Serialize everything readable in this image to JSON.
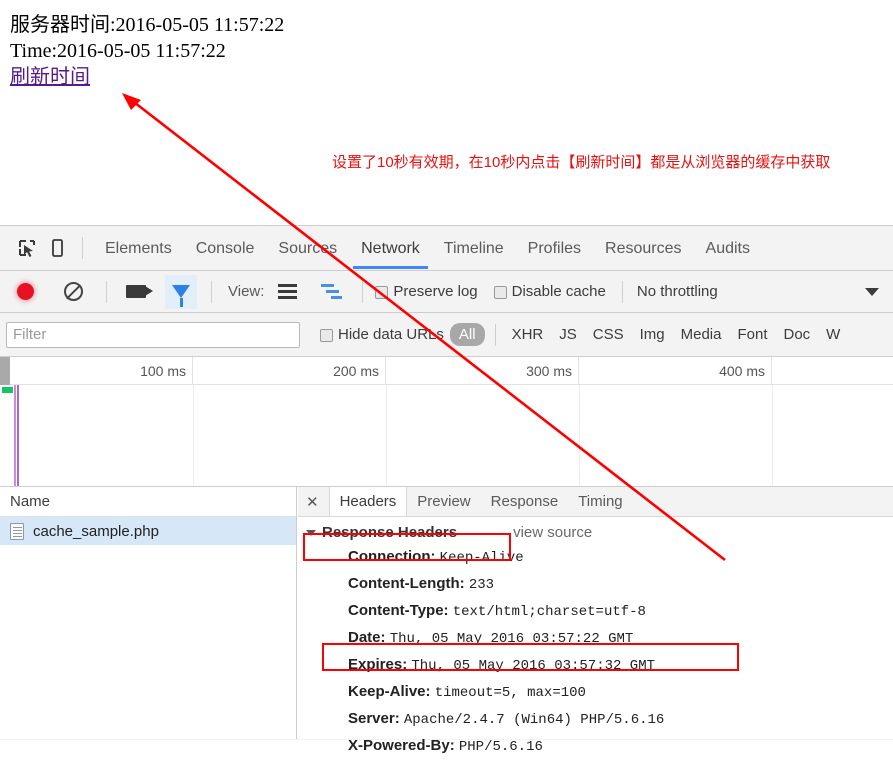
{
  "page": {
    "server_time_line": "服务器时间:2016-05-05 11:57:22",
    "time_line": "Time:2016-05-05 11:57:22",
    "refresh_link": "刷新时间",
    "annotation": "设置了10秒有效期，在10秒内点击【刷新时间】都是从浏览器的缓存中获取"
  },
  "colors": {
    "annotation_red": "#e8110f",
    "highlight_box": "#ff0000",
    "active_tab_underline": "#4285f4",
    "record_dot": "#e81123",
    "selected_row": "#d6e7f8",
    "link_purple": "#551a8b"
  },
  "devtools": {
    "inspect_icon": "inspect-element-icon",
    "device_icon": "device-toolbar-icon",
    "tabs": [
      {
        "label": "Elements",
        "active": false
      },
      {
        "label": "Console",
        "active": false
      },
      {
        "label": "Sources",
        "active": false
      },
      {
        "label": "Network",
        "active": true
      },
      {
        "label": "Timeline",
        "active": false
      },
      {
        "label": "Profiles",
        "active": false
      },
      {
        "label": "Resources",
        "active": false
      },
      {
        "label": "Audits",
        "active": false
      }
    ],
    "controls": {
      "record_icon": "record-icon",
      "clear_icon": "clear-icon",
      "camera_icon": "camera-icon",
      "filter_icon": "filter-funnel-icon",
      "view_label": "View:",
      "list_view_icon": "list-view-icon",
      "waterfall_view_icon": "waterfall-view-icon",
      "preserve_log_label": "Preserve log",
      "disable_cache_label": "Disable cache",
      "throttling_value": "No throttling",
      "throttling_caret": "chevron-down-icon"
    },
    "filterbar": {
      "filter_placeholder": "Filter",
      "filter_value": "",
      "hide_data_urls_label": "Hide data URLs",
      "types": [
        "All",
        "XHR",
        "JS",
        "CSS",
        "Img",
        "Media",
        "Font",
        "Doc",
        "W"
      ],
      "selected_type": "All"
    },
    "timeline": {
      "ticks": [
        "100 ms",
        "200 ms",
        "300 ms",
        "400 ms"
      ]
    },
    "requests": {
      "column_header": "Name",
      "rows": [
        {
          "name": "cache_sample.php",
          "icon": "document-icon",
          "selected": true
        }
      ]
    },
    "detail": {
      "close_label": "✕",
      "tabs": [
        {
          "label": "Headers",
          "active": true
        },
        {
          "label": "Preview",
          "active": false
        },
        {
          "label": "Response",
          "active": false
        },
        {
          "label": "Timing",
          "active": false
        }
      ],
      "section_title": "Response Headers",
      "view_source_label": "view source",
      "headers": [
        {
          "name": "Connection:",
          "value": "Keep-Alive"
        },
        {
          "name": "Content-Length:",
          "value": "233"
        },
        {
          "name": "Content-Type:",
          "value": "text/html;charset=utf-8"
        },
        {
          "name": "Date:",
          "value": "Thu, 05 May 2016 03:57:22 GMT"
        },
        {
          "name": "Expires:",
          "value": "Thu, 05 May 2016 03:57:32 GMT"
        },
        {
          "name": "Keep-Alive:",
          "value": "timeout=5, max=100"
        },
        {
          "name": "Server:",
          "value": "Apache/2.4.7 (Win64) PHP/5.6.16"
        },
        {
          "name": "X-Powered-By:",
          "value": "PHP/5.6.16"
        }
      ]
    }
  }
}
